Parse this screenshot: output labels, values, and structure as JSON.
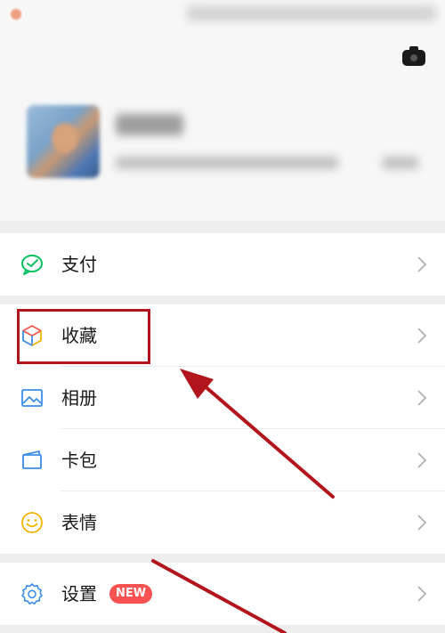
{
  "menu": {
    "pay": {
      "label": "支付",
      "icon": "wechat-pay-icon"
    },
    "favorites": {
      "label": "收藏",
      "icon": "favorites-cube-icon"
    },
    "album": {
      "label": "相册",
      "icon": "album-picture-icon"
    },
    "card_wallet": {
      "label": "卡包",
      "icon": "card-wallet-icon"
    },
    "stickers": {
      "label": "表情",
      "icon": "smiley-icon"
    },
    "settings": {
      "label": "设置",
      "icon": "gear-icon",
      "badge": "NEW"
    }
  },
  "colors": {
    "accent_green": "#07c160",
    "badge_red": "#fa5151",
    "annotation_red": "#b2161c",
    "background": "#ededed"
  }
}
